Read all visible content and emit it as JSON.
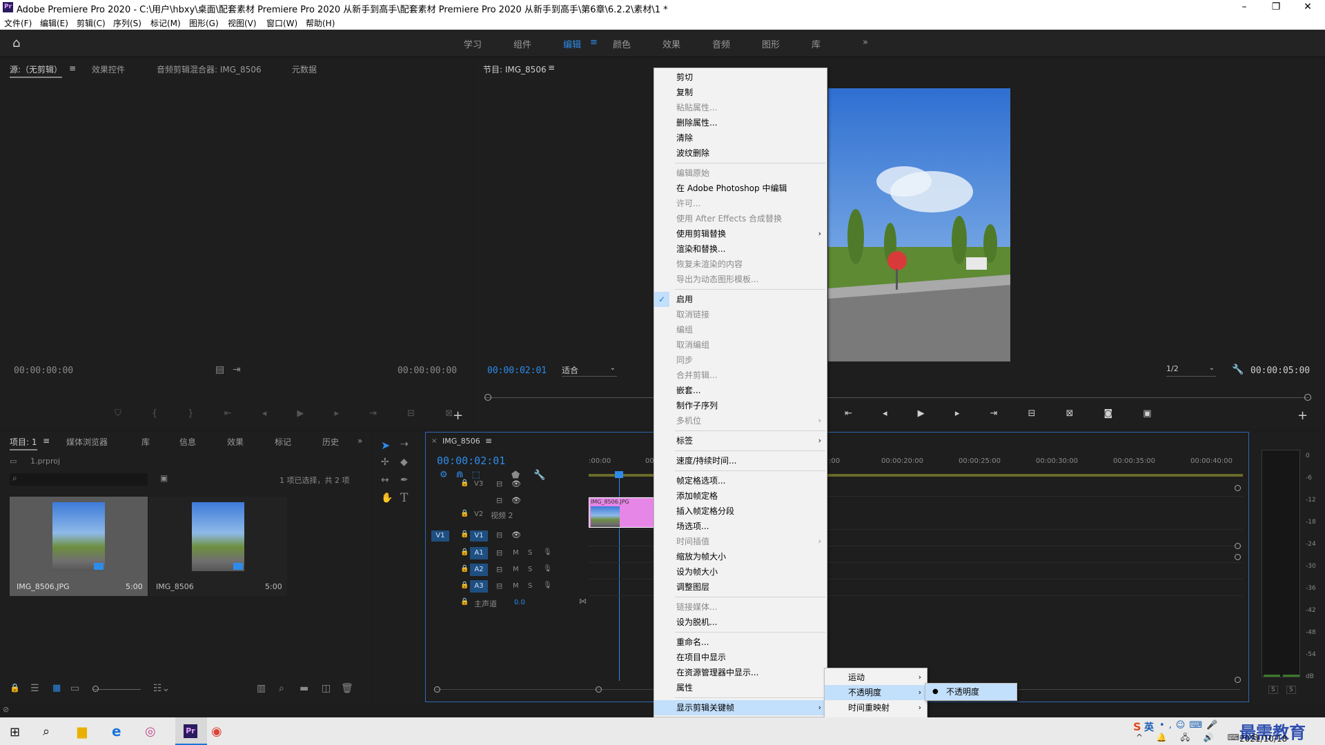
{
  "window": {
    "title": "Adobe Premiere Pro 2020 - C:\\用户\\hbxy\\桌面\\配套素材 Premiere Pro 2020 从新手到高手\\配套素材 Premiere Pro 2020 从新手到高手\\第6章\\6.2.2\\素材\\1 *",
    "logo": "Pr"
  },
  "menubar": [
    "文件(F)",
    "编辑(E)",
    "剪辑(C)",
    "序列(S)",
    "标记(M)",
    "图形(G)",
    "视图(V)",
    "窗口(W)",
    "帮助(H)"
  ],
  "workspaces": [
    "学习",
    "组件",
    "编辑",
    "颜色",
    "效果",
    "音频",
    "图形",
    "库"
  ],
  "active_workspace": "编辑",
  "source_panel": {
    "tabs": [
      "源:（无剪辑）",
      "效果控件",
      "音频剪辑混合器: IMG_8506",
      "元数据"
    ],
    "tc_left": "00:00:00:00",
    "tc_right": "00:00:00:00"
  },
  "program_panel": {
    "title": "节目: IMG_8506",
    "tc_current": "00:00:02:01",
    "fit": "适合",
    "res": "1/2",
    "tc_duration": "00:00:05:00"
  },
  "project_panel": {
    "tabs": [
      "项目: 1",
      "媒体浏览器",
      "库",
      "信息",
      "效果",
      "标记",
      "历史"
    ],
    "file": "1.prproj",
    "status": "1 项已选择，共 2 项",
    "items": [
      {
        "name": "IMG_8506.JPG",
        "duration": "5:00"
      },
      {
        "name": "IMG_8506",
        "duration": "5:00"
      }
    ]
  },
  "timeline": {
    "tab": "IMG_8506",
    "tc": "00:00:02:01",
    "ruler": [
      ":00:00",
      "00",
      ":00",
      "00:00:20:00",
      "00:00:25:00",
      "00:00:30:00",
      "00:00:35:00",
      "00:00:40:00"
    ],
    "tracks": {
      "v3": "V3",
      "v2": "V2",
      "v2_name": "视频 2",
      "v1_src": "V1",
      "v1": "V1",
      "a1": "A1",
      "a2": "A2",
      "a3": "A3",
      "master": "主声道",
      "master_val": "0.0",
      "m": "M",
      "s": "S"
    },
    "clip": "IMG_8506.JPG"
  },
  "meter": {
    "scale": [
      "0",
      "-6",
      "-12",
      "-18",
      "-24",
      "-30",
      "-36",
      "-42",
      "-48",
      "-54",
      "dB"
    ],
    "solo": [
      "S",
      "S"
    ]
  },
  "context_menu": {
    "items": [
      {
        "label": "剪切",
        "disabled": false
      },
      {
        "label": "复制",
        "disabled": false
      },
      {
        "label": "粘贴属性...",
        "disabled": true
      },
      {
        "label": "删除属性...",
        "disabled": false
      },
      {
        "label": "清除",
        "disabled": false
      },
      {
        "label": "波纹删除",
        "disabled": false
      },
      {
        "sep": true
      },
      {
        "label": "编辑原始",
        "disabled": true
      },
      {
        "label": "在 Adobe Photoshop 中编辑",
        "disabled": false
      },
      {
        "label": "许可...",
        "disabled": true
      },
      {
        "label": "使用 After Effects 合成替换",
        "disabled": true
      },
      {
        "label": "使用剪辑替换",
        "disabled": false,
        "sub": true
      },
      {
        "label": "渲染和替换...",
        "disabled": false
      },
      {
        "label": "恢复未渲染的内容",
        "disabled": true
      },
      {
        "label": "导出为动态图形模板...",
        "disabled": true
      },
      {
        "sep": true
      },
      {
        "label": "启用",
        "disabled": false,
        "checked": true
      },
      {
        "label": "取消链接",
        "disabled": true
      },
      {
        "label": "编组",
        "disabled": true
      },
      {
        "label": "取消编组",
        "disabled": true
      },
      {
        "label": "同步",
        "disabled": true
      },
      {
        "label": "合并剪辑...",
        "disabled": true
      },
      {
        "label": "嵌套...",
        "disabled": false
      },
      {
        "label": "制作子序列",
        "disabled": false
      },
      {
        "label": "多机位",
        "disabled": true,
        "sub": true
      },
      {
        "sep": true
      },
      {
        "label": "标签",
        "disabled": false,
        "sub": true
      },
      {
        "sep": true
      },
      {
        "label": "速度/持续时间...",
        "disabled": false
      },
      {
        "sep": true
      },
      {
        "label": "帧定格选项...",
        "disabled": false
      },
      {
        "label": "添加帧定格",
        "disabled": false
      },
      {
        "label": "插入帧定格分段",
        "disabled": false
      },
      {
        "label": "场选项...",
        "disabled": false
      },
      {
        "label": "时间插值",
        "disabled": true,
        "sub": true
      },
      {
        "label": "缩放为帧大小",
        "disabled": false
      },
      {
        "label": "设为帧大小",
        "disabled": false
      },
      {
        "label": "调整图层",
        "disabled": false
      },
      {
        "sep": true
      },
      {
        "label": "链接媒体...",
        "disabled": true
      },
      {
        "label": "设为脱机...",
        "disabled": false
      },
      {
        "sep": true
      },
      {
        "label": "重命名...",
        "disabled": false
      },
      {
        "label": "在项目中显示",
        "disabled": false
      },
      {
        "label": "在资源管理器中显示...",
        "disabled": false
      },
      {
        "label": "属性",
        "disabled": false
      },
      {
        "sep": true
      },
      {
        "label": "显示剪辑关键帧",
        "disabled": false,
        "sub": true,
        "highlight": true
      }
    ],
    "submenu1": [
      {
        "label": "运动",
        "highlight": false
      },
      {
        "label": "不透明度",
        "highlight": true
      },
      {
        "label": "时间重映射",
        "highlight": false
      }
    ],
    "submenu2": [
      {
        "label": "不透明度",
        "highlight": true
      }
    ]
  },
  "taskbar": {
    "date": "2021/10/18",
    "ime": "英",
    "watermark": "最需教育"
  }
}
